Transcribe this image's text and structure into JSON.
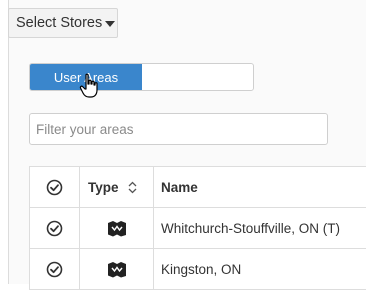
{
  "header": {
    "select_stores_label": "Select Stores"
  },
  "toggle": {
    "active_label": "User Areas",
    "inactive_label": ""
  },
  "filter": {
    "placeholder": "Filter your areas",
    "value": ""
  },
  "table": {
    "columns": [
      "Type",
      "Name"
    ],
    "rows": [
      {
        "name": "Whitchurch-Stouffville, ON (T)",
        "type_icon": "map-area-icon"
      },
      {
        "name": "Kingston, ON",
        "type_icon": "map-area-icon"
      }
    ]
  },
  "colors": {
    "accent": "#3a86cc"
  }
}
